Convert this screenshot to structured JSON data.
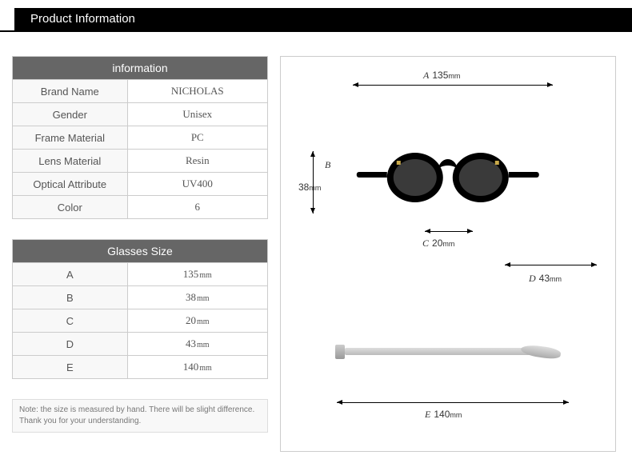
{
  "header": {
    "title": "Product Information"
  },
  "info_table": {
    "header": "information",
    "rows": [
      {
        "label": "Brand Name",
        "value": "NICHOLAS"
      },
      {
        "label": "Gender",
        "value": "Unisex"
      },
      {
        "label": "Frame Material",
        "value": "PC"
      },
      {
        "label": "Lens Material",
        "value": "Resin"
      },
      {
        "label": "Optical Attribute",
        "value": "UV400"
      },
      {
        "label": "Color",
        "value": "6"
      }
    ]
  },
  "size_table": {
    "header": "Glasses Size",
    "rows": [
      {
        "label": "A",
        "value": "135",
        "unit": "mm"
      },
      {
        "label": "B",
        "value": "38",
        "unit": "mm"
      },
      {
        "label": "C",
        "value": "20",
        "unit": "mm"
      },
      {
        "label": "D",
        "value": "43",
        "unit": "mm"
      },
      {
        "label": "E",
        "value": "140",
        "unit": "mm"
      }
    ]
  },
  "note": "Note: the size is measured by hand. There will be slight difference. Thank you for your understanding.",
  "diagram": {
    "A": {
      "letter": "A",
      "value": "135",
      "unit": "mm"
    },
    "B": {
      "letter": "B",
      "value": "38",
      "unit": "mm"
    },
    "C": {
      "letter": "C",
      "value": "20",
      "unit": "mm"
    },
    "D": {
      "letter": "D",
      "value": "43",
      "unit": "mm"
    },
    "E": {
      "letter": "E",
      "value": "140",
      "unit": "mm"
    }
  }
}
